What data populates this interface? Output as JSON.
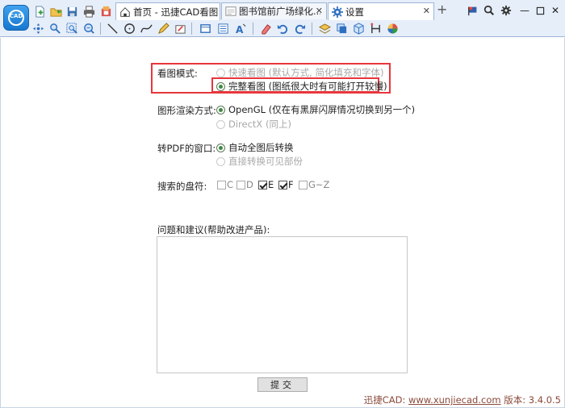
{
  "tabs": [
    {
      "label": "首页 - 迅捷CAD看图",
      "icon": "home-icon",
      "closable": false
    },
    {
      "label": "图书馆前广场绿化...",
      "icon": "document-icon",
      "closable": true
    },
    {
      "label": "设置",
      "icon": "gear-icon",
      "closable": true
    }
  ],
  "new_tab": "+",
  "logo_text": "CAD",
  "settings": {
    "view_mode_label": "看图模式:",
    "view_mode_options": [
      {
        "label": "快速看图 (默认方式, 简化填充和字体)",
        "selected": false,
        "enabled": false
      },
      {
        "label": "完整看图 (图纸很大时有可能打开较慢)",
        "selected": true,
        "enabled": true
      }
    ],
    "render_label": "图形渲染方式:",
    "render_options": [
      {
        "label": "OpenGL (仅在有黑屏闪屏情况切换到另一个)",
        "selected": true,
        "enabled": true
      },
      {
        "label": "DirectX  (同上)",
        "selected": false,
        "enabled": false
      }
    ],
    "pdf_label": "转PDF的窗口:",
    "pdf_options": [
      {
        "label": "自动全图后转换",
        "selected": true,
        "enabled": true
      },
      {
        "label": "直接转换可见部份",
        "selected": false,
        "enabled": false
      }
    ],
    "drives_label": "搜索的盘符:",
    "drives": [
      {
        "label": "C",
        "checked": false
      },
      {
        "label": "D",
        "checked": false
      },
      {
        "label": "E",
        "checked": true
      },
      {
        "label": "F",
        "checked": true
      },
      {
        "label": "G~Z",
        "checked": false
      }
    ],
    "feedback_label": "问题和建议(帮助改进产品):",
    "feedback_value": "",
    "submit_label": "提交"
  },
  "footer": {
    "brand": "迅捷CAD: ",
    "url": "www.xunjiecad.com",
    "version": " 版本: 3.4.0.5"
  },
  "colors": {
    "highlight_box": "#e8363c",
    "toolbar_bg": "#e6eef9",
    "accent_blue": "#1877cf"
  }
}
